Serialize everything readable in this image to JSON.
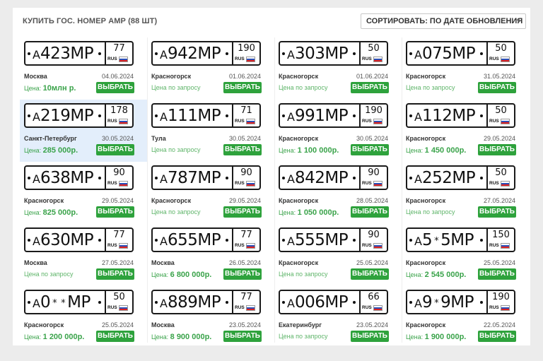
{
  "header": {
    "title": "КУПИТЬ ГОС. НОМЕР АМР (88 ШТ)",
    "sort_label": "СОРТИРОВАТЬ: ПО ДАТЕ ОБНОВЛЕНИЯ"
  },
  "ui": {
    "price_prefix": "Цена: ",
    "price_on_request": "Цена по запросу",
    "select_button": "ВЫБРАТЬ",
    "rus": "RUS"
  },
  "listings": [
    {
      "letter": "А",
      "digits": "423",
      "suffix": "МР",
      "region": "77",
      "city": "Москва",
      "date": "04.06.2024",
      "price": "10млн р."
    },
    {
      "letter": "А",
      "digits": "942",
      "suffix": "МР",
      "region": "190",
      "city": "Красногорск",
      "date": "01.06.2024",
      "price": null
    },
    {
      "letter": "А",
      "digits": "303",
      "suffix": "МР",
      "region": "50",
      "city": "Красногорск",
      "date": "01.06.2024",
      "price": null
    },
    {
      "letter": "А",
      "digits": "075",
      "suffix": "МР",
      "region": "50",
      "city": "Красногорск",
      "date": "31.05.2024",
      "price": null
    },
    {
      "letter": "А",
      "digits": "219",
      "suffix": "МР",
      "region": "178",
      "city": "Санкт-Петербург",
      "date": "30.05.2024",
      "price": "285 000р.",
      "highlighted": true
    },
    {
      "letter": "А",
      "digits": "111",
      "suffix": "МР",
      "region": "71",
      "city": "Тула",
      "date": "30.05.2024",
      "price": null
    },
    {
      "letter": "А",
      "digits": "991",
      "suffix": "МР",
      "region": "190",
      "city": "Красногорск",
      "date": "30.05.2024",
      "price": "1 100 000р."
    },
    {
      "letter": "А",
      "digits": "112",
      "suffix": "МР",
      "region": "50",
      "city": "Красногорск",
      "date": "29.05.2024",
      "price": "1 450 000р."
    },
    {
      "letter": "А",
      "digits": "638",
      "suffix": "МР",
      "region": "90",
      "city": "Красногорск",
      "date": "29.05.2024",
      "price": "825 000р."
    },
    {
      "letter": "А",
      "digits": "787",
      "suffix": "МР",
      "region": "90",
      "city": "Красногорск",
      "date": "29.05.2024",
      "price": null
    },
    {
      "letter": "А",
      "digits": "842",
      "suffix": "МР",
      "region": "90",
      "city": "Красногорск",
      "date": "28.05.2024",
      "price": "1 050 000р."
    },
    {
      "letter": "А",
      "digits": "252",
      "suffix": "МР",
      "region": "50",
      "city": "Красногорск",
      "date": "27.05.2024",
      "price": null
    },
    {
      "letter": "А",
      "digits": "630",
      "suffix": "МР",
      "region": "77",
      "city": "Москва",
      "date": "27.05.2024",
      "price": null
    },
    {
      "letter": "А",
      "digits": "655",
      "suffix": "МР",
      "region": "77",
      "city": "Москва",
      "date": "26.05.2024",
      "price": "6 800 000р."
    },
    {
      "letter": "А",
      "digits": "555",
      "suffix": "МР",
      "region": "90",
      "city": "Красногорск",
      "date": "25.05.2024",
      "price": null
    },
    {
      "letter": "А",
      "digits": "5*5",
      "suffix": "МР",
      "region": "150",
      "city": "Красногорск",
      "date": "25.05.2024",
      "price": "2 545 000р."
    },
    {
      "letter": "А",
      "digits": "0**",
      "suffix": "МР",
      "region": "50",
      "city": "Красногорск",
      "date": "25.05.2024",
      "price": "1 200 000р."
    },
    {
      "letter": "А",
      "digits": "889",
      "suffix": "МР",
      "region": "77",
      "city": "Москва",
      "date": "23.05.2024",
      "price": "8 900 000р."
    },
    {
      "letter": "А",
      "digits": "006",
      "suffix": "МР",
      "region": "66",
      "city": "Екатеринбург",
      "date": "23.05.2024",
      "price": null
    },
    {
      "letter": "А",
      "digits": "9*9",
      "suffix": "МР",
      "region": "190",
      "city": "Красногорск",
      "date": "22.05.2024",
      "price": "1 900 000р."
    }
  ],
  "colors": {
    "accent_green": "#2ea23c",
    "price_green": "#3aa34a",
    "highlight": "#e3eefb"
  }
}
